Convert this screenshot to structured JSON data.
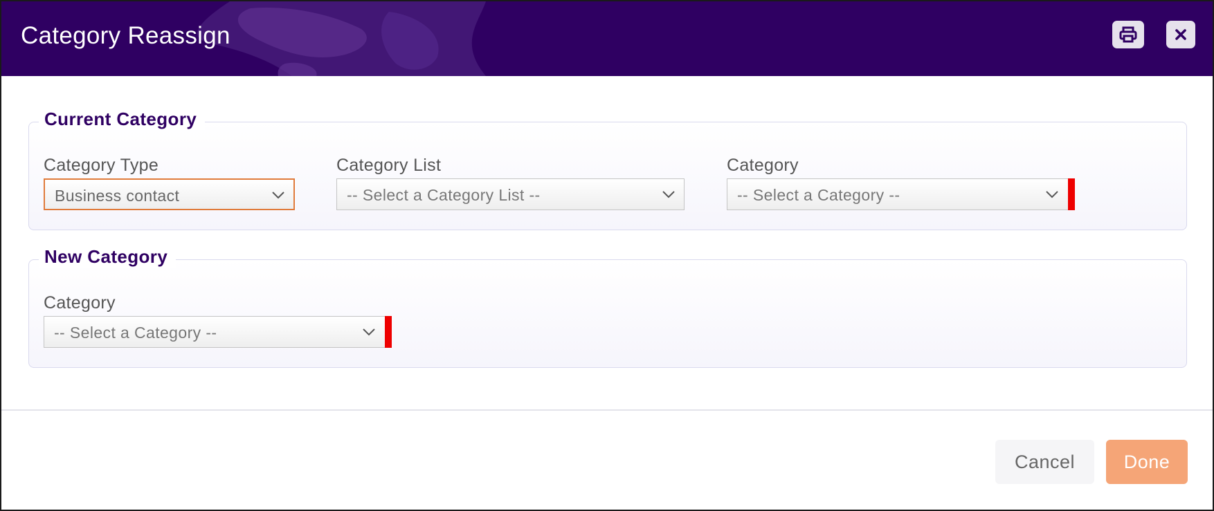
{
  "dialog": {
    "title": "Category Reassign",
    "header_color": "#2f0062",
    "icons": {
      "print": "print-icon",
      "close": "close-icon"
    }
  },
  "current_category": {
    "legend": "Current Category",
    "category_type": {
      "label": "Category Type",
      "value": "Business contact"
    },
    "category_list": {
      "label": "Category List",
      "placeholder": "-- Select a Category List --"
    },
    "category": {
      "label": "Category",
      "placeholder": "-- Select a Category --",
      "required": true
    }
  },
  "new_category": {
    "legend": "New Category",
    "category": {
      "label": "Category",
      "placeholder": "-- Select a Category --",
      "required": true
    }
  },
  "footer": {
    "cancel_label": "Cancel",
    "done_label": "Done",
    "done_color": "#f5a577"
  },
  "colors": {
    "accent": "#2f0062",
    "required_marker": "#ee0000",
    "focus_border": "#e07a3a"
  }
}
